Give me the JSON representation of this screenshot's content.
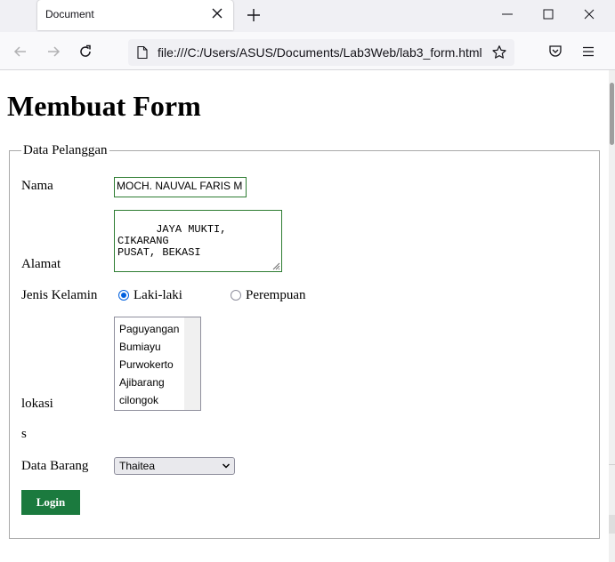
{
  "browser": {
    "tab_title": "Document",
    "url": "file:///C:/Users/ASUS/Documents/Lab3Web/lab3_form.html"
  },
  "page": {
    "heading": "Membuat Form",
    "legend": "Data Pelanggan",
    "nama": {
      "label": "Nama",
      "value": "MOCH. NAUVAL FARIS M"
    },
    "alamat": {
      "label": "Alamat",
      "value": "JAYA MUKTI, CIKARANG\nPUSAT, BEKASI"
    },
    "gender": {
      "label": "Jenis Kelamin",
      "options": [
        {
          "label": "Laki-laki",
          "checked": true
        },
        {
          "label": "Perempuan",
          "checked": false
        }
      ]
    },
    "lokasi": {
      "label": "lokasi",
      "options": [
        "Paguyangan",
        "Bumiayu",
        "Purwokerto",
        "Ajibarang",
        "cilongok"
      ]
    },
    "stray_text": "s",
    "barang": {
      "label": "Data Barang",
      "selected": "Thaitea"
    },
    "submit_label": "Login"
  },
  "colors": {
    "button_bg": "#1b7a3e",
    "input_border": "#2e7d32",
    "radio_accent": "#0060df"
  },
  "icons": [
    "close-icon",
    "plus-icon",
    "minimize-icon",
    "maximize-icon",
    "back-icon",
    "forward-icon",
    "reload-icon",
    "file-icon",
    "star-icon",
    "pocket-icon",
    "menu-icon",
    "chevron-down-icon"
  ]
}
